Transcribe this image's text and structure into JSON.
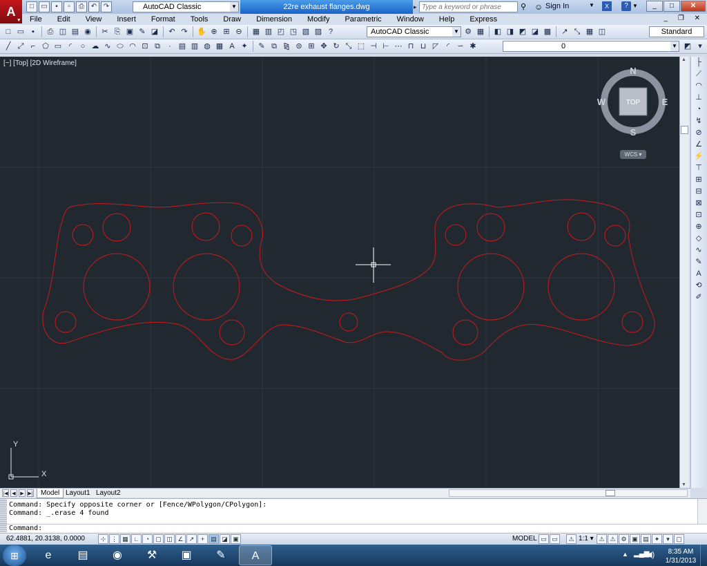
{
  "app": {
    "logo_letter": "A",
    "logo_mark": "▾",
    "doc_title": "22re exhaust flanges.dwg",
    "workspace": "AutoCAD Classic",
    "search_placeholder": "Type a keyword or phrase",
    "signin": "Sign In"
  },
  "menu": [
    "File",
    "Edit",
    "View",
    "Insert",
    "Format",
    "Tools",
    "Draw",
    "Dimension",
    "Modify",
    "Parametric",
    "Window",
    "Help",
    "Express"
  ],
  "toolbar1": {
    "workspace_combo": "AutoCAD Classic",
    "text_style": "Standard"
  },
  "toolbar2": {
    "layer": "0"
  },
  "viewport": {
    "label": "[−] [Top] [2D Wireframe]",
    "viewcube": {
      "north": "N",
      "south": "S",
      "east": "E",
      "west": "W",
      "face": "TOP"
    },
    "wcs": "WCS ▾",
    "ucs_x": "X",
    "ucs_y": "Y",
    "accent_line": "#cc1a1a"
  },
  "tabs": [
    "Model",
    "Layout1",
    "Layout2"
  ],
  "command": {
    "history": [
      "Command: Specify opposite corner or [Fence/WPolygon/CPolygon]:",
      "Command: _.erase 4 found"
    ],
    "prompt": "Command:"
  },
  "status": {
    "coords": "62.4881, 20.3138, 0.0000",
    "model": "MODEL",
    "scale": "1:1 ▾"
  },
  "taskbar": {
    "time": "8:35 AM",
    "date": "1/31/2013",
    "apps": [
      "windows-explorer",
      "internet-explorer",
      "file-explorer",
      "chrome",
      "cnc-app",
      "monitor-app",
      "paint-app",
      "autocad"
    ]
  }
}
